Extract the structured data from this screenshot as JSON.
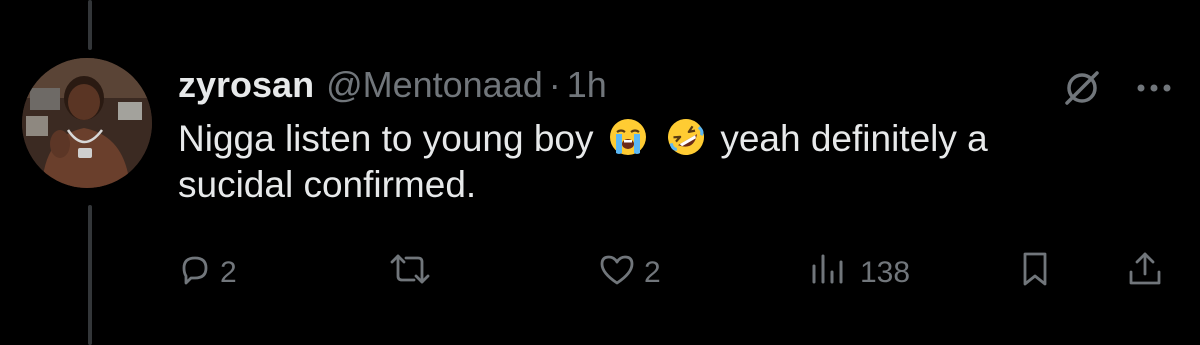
{
  "tweet": {
    "display_name": "zyrosan",
    "handle": "@Mentonaad",
    "separator": "·",
    "time": "1h",
    "text_line1": "Nigga listen to young boy",
    "text_line1_after": "yeah definitely a",
    "text_line2": "sucidal confirmed.",
    "emojis": [
      "loudly-crying-face",
      "rolling-on-floor-laughing"
    ]
  },
  "actions": {
    "replies": "2",
    "reposts": "",
    "likes": "2",
    "views": "138"
  },
  "colors": {
    "background": "#000000",
    "primary_text": "#e7e9ea",
    "secondary_text": "#71767b",
    "thread_line": "#333639"
  }
}
